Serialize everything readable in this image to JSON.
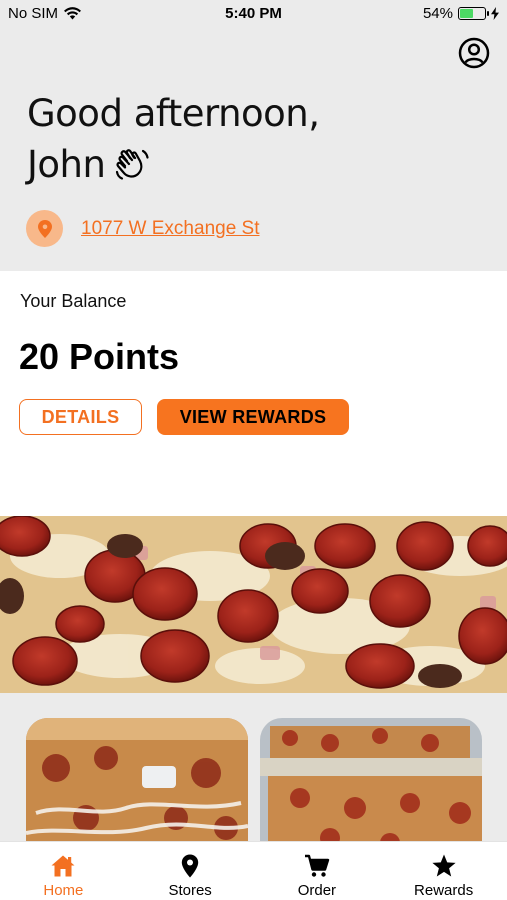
{
  "status_bar": {
    "carrier": "No SIM",
    "time": "5:40 PM",
    "battery_percent": "54%",
    "battery_level": 0.54
  },
  "header": {
    "greeting_line1": "Good afternoon,",
    "greeting_line2": "John",
    "address": "1077 W Exchange St"
  },
  "balance": {
    "label": "Your Balance",
    "points": "20 Points",
    "details_label": "DETAILS",
    "rewards_label": "VIEW REWARDS"
  },
  "tabs": [
    {
      "label": "Home",
      "icon": "home-icon",
      "active": true
    },
    {
      "label": "Stores",
      "icon": "location-pin-icon",
      "active": false
    },
    {
      "label": "Order",
      "icon": "cart-icon",
      "active": false
    },
    {
      "label": "Rewards",
      "icon": "star-icon",
      "active": false
    }
  ],
  "colors": {
    "accent": "#f37021",
    "header_bg": "#ebebeb",
    "pin_bg": "#f8b88a"
  }
}
